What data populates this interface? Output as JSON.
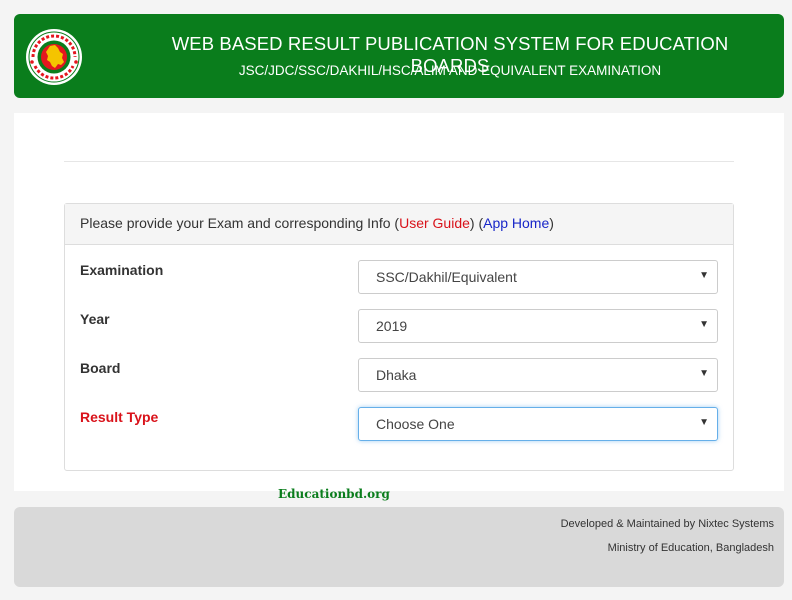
{
  "header": {
    "title": "WEB BASED RESULT PUBLICATION SYSTEM FOR EDUCATION BOARDS",
    "subtitle": "JSC/JDC/SSC/DAKHIL/HSC/ALIM AND EQUIVALENT EXAMINATION",
    "logo_icon": "bangladesh-government-seal-icon"
  },
  "panel": {
    "prompt_prefix": "Please provide your Exam and corresponding Info (",
    "user_guide_label": "User Guide",
    "mid": ") (",
    "app_home_label": "App Home",
    "suffix": ")"
  },
  "form": {
    "examination": {
      "label": "Examination",
      "value": "SSC/Dakhil/Equivalent"
    },
    "year": {
      "label": "Year",
      "value": "2019"
    },
    "board": {
      "label": "Board",
      "value": "Dhaka"
    },
    "result_type": {
      "label": "Result Type",
      "value": "Choose One"
    },
    "caret_glyph": "▼"
  },
  "watermark": "Educationbd.org",
  "footer": {
    "developer": "Developed & Maintained by Nixtec Systems",
    "ministry": "Ministry of Education, Bangladesh"
  },
  "colors": {
    "header_green": "#0a7d1c",
    "link_red": "#d9121a",
    "link_blue": "#1826c8",
    "footer_gray": "#d9d9d9"
  }
}
